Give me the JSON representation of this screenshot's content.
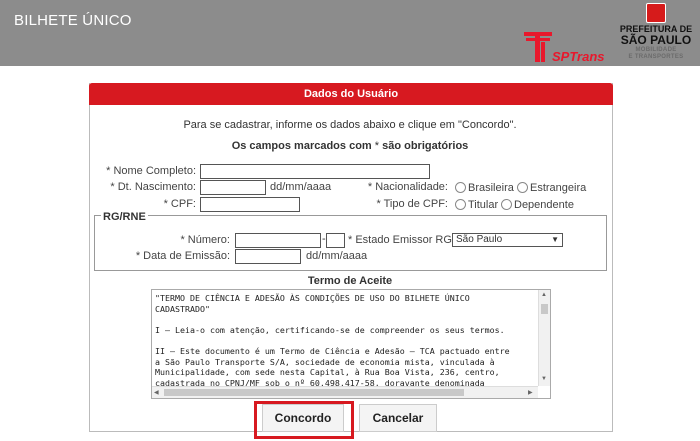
{
  "header": {
    "app_title": "BILHETE ÚNICO",
    "sptrans_text": "SPTrans",
    "pref_line1": "PREFEITURA DE",
    "pref_line2": "SÃO PAULO",
    "pref_line3a": "MOBILIDADE",
    "pref_line3b": "E TRANSPORTES"
  },
  "panel": {
    "title": "Dados do Usuário",
    "intro": "Para se cadastrar, informe os dados abaixo e clique em \"Concordo\".",
    "required_note_prefix": "Os campos marcados com",
    "required_note_star": "*",
    "required_note_suffix": "são obrigatórios"
  },
  "form": {
    "nome_label": "* Nome Completo:",
    "nome_value": "",
    "nasc_label": "* Dt. Nascimento:",
    "nasc_value": "",
    "nasc_hint": "dd/mm/aaaa",
    "nacionalidade_label": "* Nacionalidade:",
    "nacionalidade_options": [
      "Brasileira",
      "Estrangeira"
    ],
    "cpf_label": "* CPF:",
    "cpf_value": "",
    "tipo_cpf_label": "* Tipo de CPF:",
    "tipo_cpf_options": [
      "Titular",
      "Dependente"
    ]
  },
  "rg": {
    "legend": "RG/RNE",
    "numero_label": "* Número:",
    "numero_value": "",
    "digito_value": "",
    "dash": "-",
    "estado_label": "* Estado Emissor RG:",
    "estado_selected": "São Paulo",
    "emissao_label": "* Data de Emissão:",
    "emissao_value": "",
    "emissao_hint": "dd/mm/aaaa"
  },
  "terms": {
    "title": "Termo de Aceite",
    "text": "\"TERMO DE CIÊNCIA E ADESÃO ÀS CONDIÇÕES DE USO DO BILHETE ÚNICO\nCADASTRADO\"\n\nI – Leia-o com atenção, certificando-se de compreender os seus termos.\n\nII – Este documento é um Termo de Ciência e Adesão – TCA pactuado entre\na São Paulo Transporte S/A, sociedade de economia mista, vinculada à\nMunicipalidade, com sede nesta Capital, à Rua Boa Vista, 236, centro,\ncadastrada no CPNJ/MF sob o nº 60.498.417-58, doravante denominada"
  },
  "buttons": {
    "concordo": "Concordo",
    "cancelar": "Cancelar"
  },
  "colors": {
    "header_bg": "#8c8c8c",
    "accent_red": "#d71920"
  }
}
